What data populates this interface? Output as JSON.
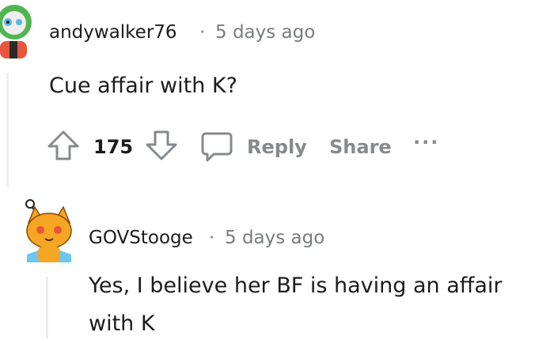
{
  "comments": [
    {
      "author": "andywalker76",
      "separator": "·",
      "time": "5 days ago",
      "body": "Cue affair with K?",
      "votes": "175",
      "actions": {
        "reply": "Reply",
        "share": "Share",
        "more": "···"
      },
      "avatar_icon": "reddit-avatar-icon"
    },
    {
      "author": "GOVStooge",
      "separator": "·",
      "time": "5 days ago",
      "body": "Yes, I believe her BF is having an affair with K",
      "avatar_icon": "snoo-cat-avatar-icon"
    }
  ],
  "colors": {
    "meta_gray": "#787c7e",
    "action_gray": "#878a8c",
    "thread_line": "#edeff1"
  }
}
